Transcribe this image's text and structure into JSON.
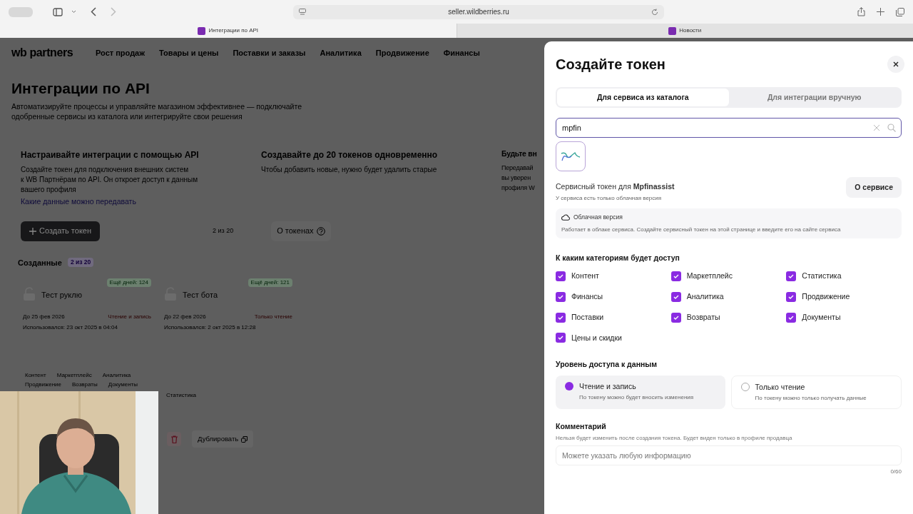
{
  "browser": {
    "url": "seller.wildberries.ru",
    "tabs": [
      {
        "label": "Интеграции по API",
        "selected": true
      },
      {
        "label": "Новости",
        "selected": false
      }
    ]
  },
  "nav": {
    "logo": "wb partners",
    "items": [
      "Рост продаж",
      "Товары и цены",
      "Поставки и заказы",
      "Аналитика",
      "Продвижение",
      "Финансы"
    ]
  },
  "page": {
    "title": "Интеграции по API",
    "subtitle": "Автоматизируйте процессы и управляйте магазином эффективнее — подключайте одобренные сервисы из каталога или интегрируйте свои решения",
    "cards": [
      {
        "title": "Настраивайте интеграции с помощью API",
        "lines": [
          "Создайте токен для подключения внешних систем",
          "к WB Партнёрам по API. Он откроет доступ к данным",
          "вашего профиля"
        ],
        "link": "Какие данные можно передавать"
      },
      {
        "title": "Создавайте до 20 токенов одновременно",
        "lines": [
          "Чтобы добавить новые, нужно будет удалить старые"
        ]
      },
      {
        "title": "Будьте вн",
        "lines": [
          "Передавай",
          "вы уверен",
          "профиля W"
        ]
      }
    ],
    "create_button": "Создать токен",
    "counter": "2 из 20",
    "about_button": "О токенах",
    "token_tabs": [
      {
        "label": "Созданные",
        "count": "2 из 20",
        "selected": true
      }
    ],
    "tokens": [
      {
        "name": "Тест руклю",
        "days_left": "Ещё дней: 124",
        "until": "До 25 фев 2026",
        "access": "Чтение и запись",
        "used": "Использовался: 23 окт 2025 в 04:04",
        "tags": [
          "Контент",
          "Маркетплейс",
          "Аналитика",
          "Продвижение",
          "Возвраты",
          "Документы"
        ]
      },
      {
        "name": "Тест бота",
        "days_left": "Ещё дней: 121",
        "until": "До 22 фев 2026",
        "access": "Только чтение",
        "used": "Использовался: 2 окт 2025 в 12:28",
        "tags": [
          "Статистика"
        ],
        "duplicate_button": "Дублировать"
      }
    ]
  },
  "modal": {
    "title": "Создайте токен",
    "tabs": [
      {
        "label": "Для сервиса из каталога",
        "selected": true
      },
      {
        "label": "Для интеграции вручную",
        "selected": false
      }
    ],
    "search": {
      "value": "mpfin"
    },
    "service": {
      "title": "Сервисный токен для **Mpfinassist**",
      "subtitle": "У сервиса есть только облачная версия",
      "button": "О сервисе"
    },
    "cloud": {
      "title": "Облачная версия",
      "text": "Работает в облаке сервиса. Создайте сервисный токен на этой странице и введите его на сайте сервиса"
    },
    "categories_heading": "К каким категориям будет доступ",
    "categories": [
      {
        "label": "Контент",
        "checked": true
      },
      {
        "label": "Маркетплейс",
        "checked": true
      },
      {
        "label": "Статистика",
        "checked": true
      },
      {
        "label": "Финансы",
        "checked": true
      },
      {
        "label": "Аналитика",
        "checked": true
      },
      {
        "label": "Продвижение",
        "checked": true
      },
      {
        "label": "Поставки",
        "checked": true
      },
      {
        "label": "Возвраты",
        "checked": true
      },
      {
        "label": "Документы",
        "checked": true
      },
      {
        "label": "Цены и скидки",
        "checked": true
      }
    ],
    "access_heading": "Уровень доступа к данным",
    "access_options": [
      {
        "label": "Чтение и запись",
        "hint": "По токену можно будет вносить изменения",
        "selected": true
      },
      {
        "label": "Только чтение",
        "hint": "По токену можно только получать данные",
        "selected": false
      }
    ],
    "comment": {
      "heading": "Комментарий",
      "hint": "Нельзя будет изменить после создания токена. Будет виден только в профиле продавца",
      "placeholder": "Можете указать любую информацию",
      "counter": "0/60"
    }
  }
}
